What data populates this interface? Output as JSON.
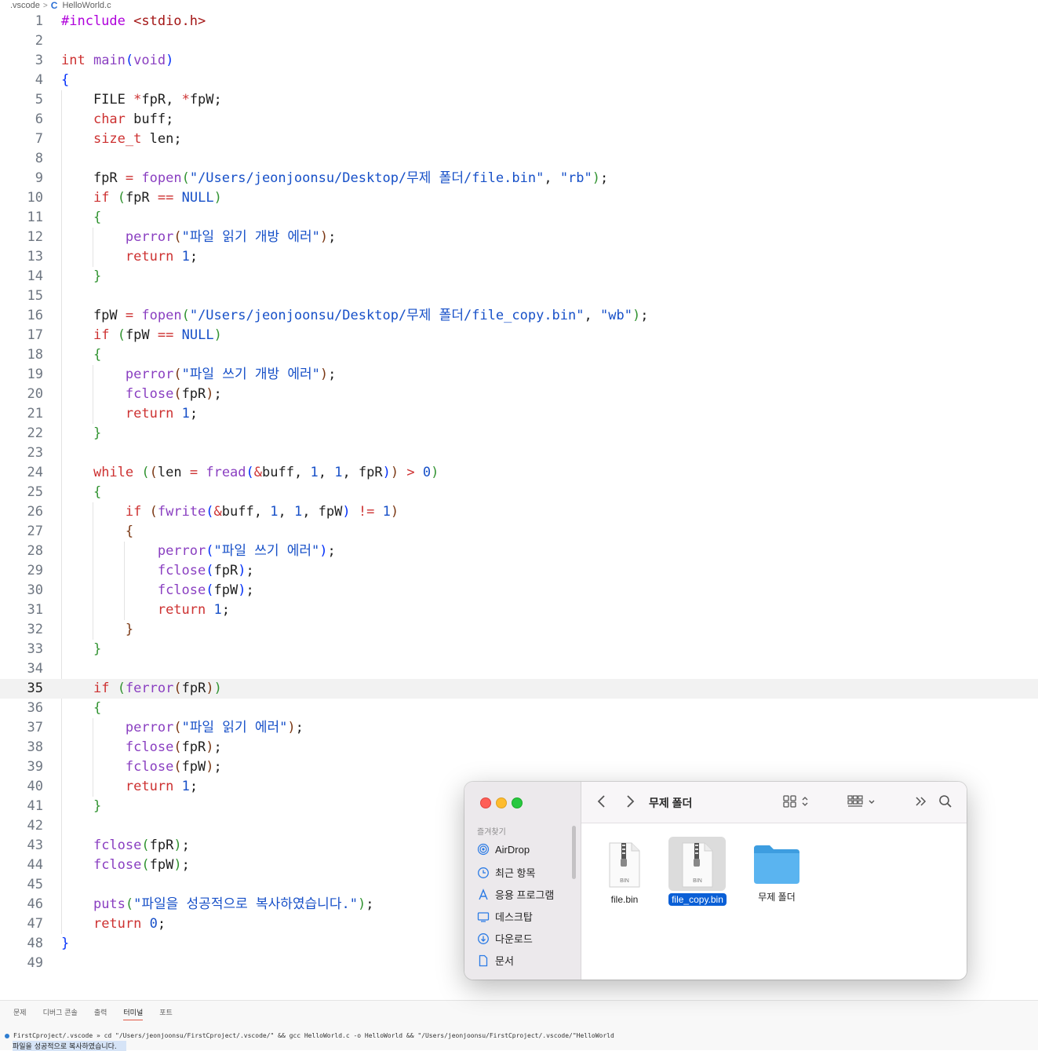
{
  "breadcrumb": {
    "folder": ".vscode",
    "separator": ">",
    "file_icon": "C",
    "file": "HelloWorld.c"
  },
  "editor": {
    "current_line": 35,
    "line_numbers": [
      "1",
      "2",
      "3",
      "4",
      "5",
      "6",
      "7",
      "8",
      "9",
      "10",
      "11",
      "12",
      "13",
      "14",
      "15",
      "16",
      "17",
      "18",
      "19",
      "20",
      "21",
      "22",
      "23",
      "24",
      "25",
      "26",
      "27",
      "28",
      "29",
      "30",
      "31",
      "32",
      "33",
      "34",
      "35",
      "36",
      "37",
      "38",
      "39",
      "40",
      "41",
      "42",
      "43",
      "44",
      "45",
      "46",
      "47",
      "48",
      "49"
    ],
    "lines": [
      "#include <stdio.h>",
      "",
      "int main(void)",
      "{",
      "    FILE *fpR, *fpW;",
      "    char buff;",
      "    size_t len;",
      "",
      "    fpR = fopen(\"/Users/jeonjoonsu/Desktop/무제 폴더/file.bin\", \"rb\");",
      "    if (fpR == NULL)",
      "    {",
      "        perror(\"파일 읽기 개방 에러\");",
      "        return 1;",
      "    }",
      "",
      "    fpW = fopen(\"/Users/jeonjoonsu/Desktop/무제 폴더/file_copy.bin\", \"wb\");",
      "    if (fpW == NULL)",
      "    {",
      "        perror(\"파일 쓰기 개방 에러\");",
      "        fclose(fpR);",
      "        return 1;",
      "    }",
      "",
      "    while ((len = fread(&buff, 1, 1, fpR)) > 0)",
      "    {",
      "        if (fwrite(&buff, 1, 1, fpW) != 1)",
      "        {",
      "            perror(\"파일 쓰기 에러\");",
      "            fclose(fpR);",
      "            fclose(fpW);",
      "            return 1;",
      "        }",
      "    }",
      "",
      "    if (ferror(fpR))",
      "    {",
      "        perror(\"파일 읽기 에러\");",
      "        fclose(fpR);",
      "        fclose(fpW);",
      "        return 1;",
      "    }",
      "",
      "    fclose(fpR);",
      "    fclose(fpW);",
      "",
      "    puts(\"파일을 성공적으로 복사하였습니다.\");",
      "    return 0;",
      "}",
      ""
    ]
  },
  "panel": {
    "tabs": [
      "문제",
      "디버그 콘솔",
      "출력",
      "터미널",
      "포트"
    ],
    "active_tab": "터미널",
    "terminal_command": "FirstCproject/.vscode » cd \"/Users/jeonjoonsu/FirstCproject/.vscode/\" && gcc HelloWorld.c -o HelloWorld && \"/Users/jeonjoonsu/FirstCproject/.vscode/\"HelloWorld",
    "terminal_output": "파일을 성공적으로 복사하였습니다."
  },
  "finder": {
    "title": "무제 폴더",
    "sidebar_header": "즐겨찾기",
    "sidebar_items": [
      {
        "label": "AirDrop",
        "icon": "airdrop-icon"
      },
      {
        "label": "최근 항목",
        "icon": "clock-icon"
      },
      {
        "label": "응용 프로그램",
        "icon": "applications-icon"
      },
      {
        "label": "데스크탑",
        "icon": "desktop-icon"
      },
      {
        "label": "다운로드",
        "icon": "download-icon"
      },
      {
        "label": "문서",
        "icon": "document-icon"
      }
    ],
    "files": [
      {
        "name": "file.bin",
        "badge": "BIN",
        "selected": false,
        "icon": "bin-file-icon"
      },
      {
        "name": "file_copy.bin",
        "badge": "BIN",
        "selected": true,
        "icon": "bin-file-icon"
      },
      {
        "name": "무제 폴더",
        "selected": false,
        "icon": "folder-icon"
      }
    ],
    "colors": {
      "accent": "#0a5fd6",
      "folder": "#5ab4f0",
      "close": "#fe5f57",
      "minimize": "#febc2e",
      "zoom": "#28c840"
    }
  }
}
